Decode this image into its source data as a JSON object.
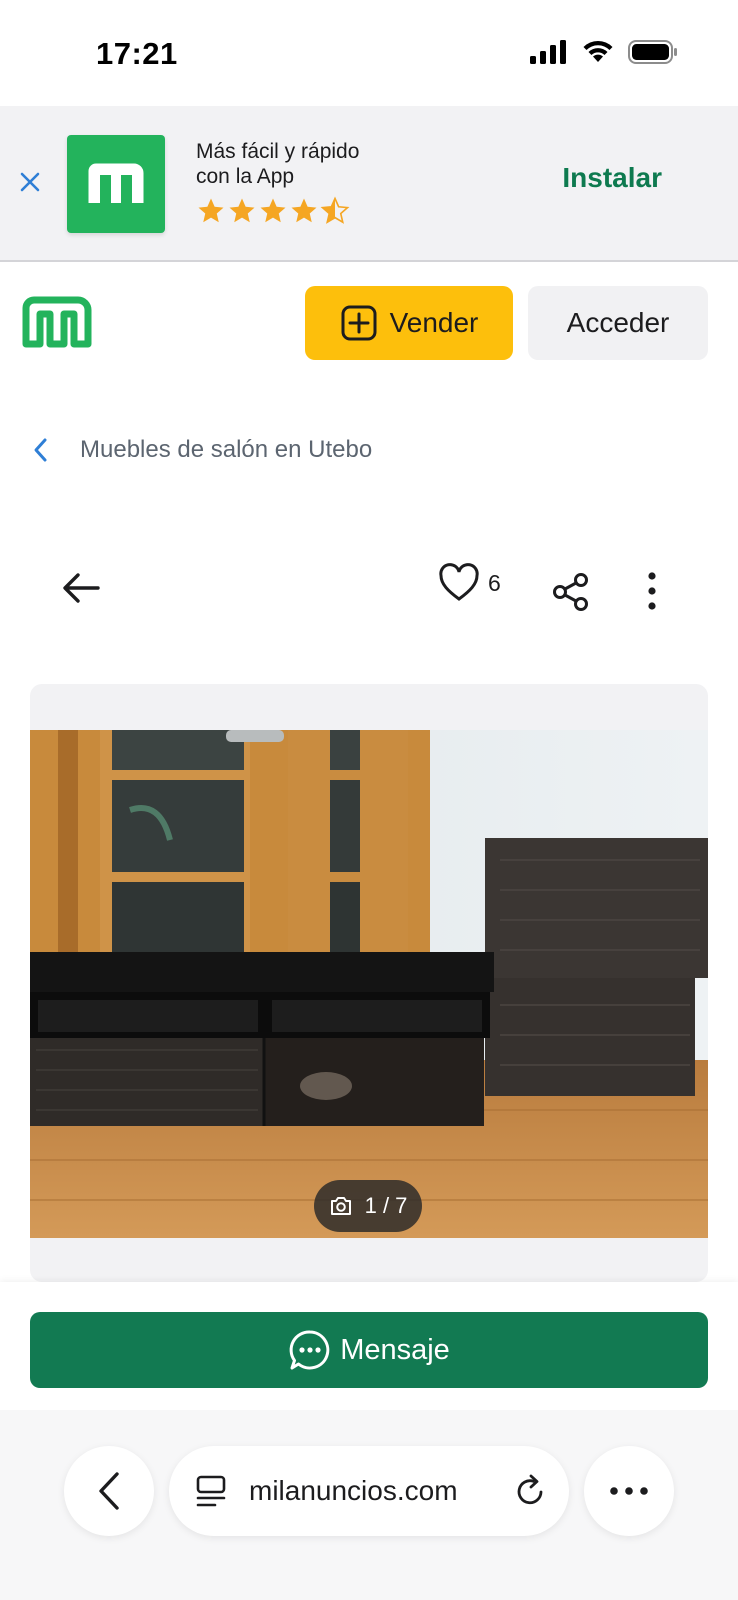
{
  "status_bar": {
    "time": "17:21",
    "icons": [
      "signal-icon",
      "wifi-icon",
      "battery-icon"
    ]
  },
  "app_banner": {
    "line1": "Más fácil y rápido",
    "line2": "con la App",
    "rating": 4.5,
    "install_label": "Instalar",
    "brand_color": "#23b35c",
    "install_color": "#0e7a4f",
    "star_color": "#f5a623"
  },
  "header": {
    "sell_label": "Vender",
    "login_label": "Acceder",
    "sell_color": "#fdbf0c"
  },
  "breadcrumb": {
    "label": "Muebles de salón en Utebo"
  },
  "actions": {
    "favorites_count": "6"
  },
  "gallery": {
    "counter": "1 / 7",
    "current": 1,
    "total": 7
  },
  "message": {
    "label": "Mensaje",
    "color": "#127a52"
  },
  "browser": {
    "url": "milanuncios.com"
  }
}
